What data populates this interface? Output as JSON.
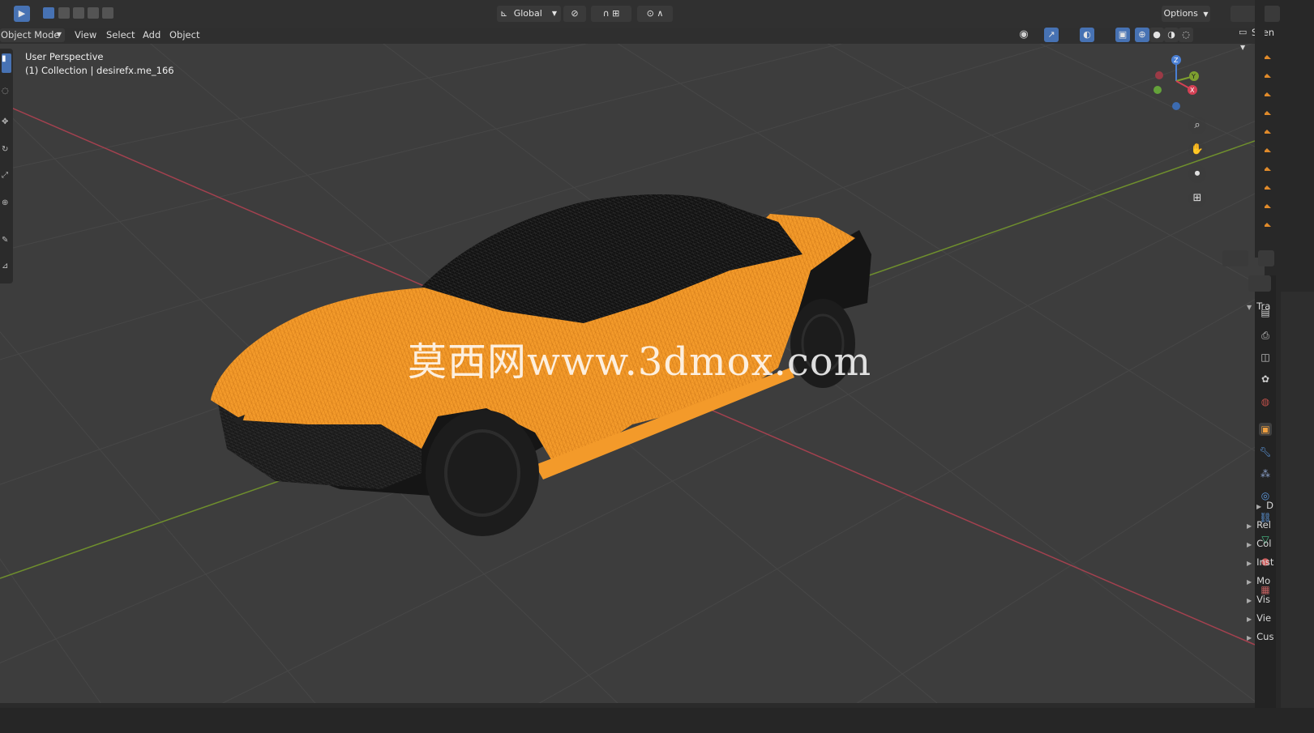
{
  "header": {
    "transform_orientation": "Global",
    "options_label": "Options"
  },
  "menubar": {
    "mode": "Object Mode",
    "items": [
      "View",
      "Select",
      "Add",
      "Object"
    ]
  },
  "viewport": {
    "perspective_label": "User Perspective",
    "collection_label": "(1) Collection | desirefx.me_166",
    "watermark": "莫西网www.3dmox.com",
    "axis_labels": {
      "z": "Z",
      "y": "Y",
      "x": "X"
    }
  },
  "outliner": {
    "title": "Scen"
  },
  "properties": {
    "section_transform": "Tra",
    "collapsed_sections": [
      "Rel",
      "Col",
      "Inst",
      "Mo",
      "Vis",
      "Vie",
      "Cus"
    ],
    "delta_label": "D"
  },
  "colors": {
    "accent_blue": "#4772b3",
    "wireframe_orange": "#f39a2a",
    "x_axis": "#a3414f",
    "y_axis": "#6f8f2d",
    "background": "#3d3d3d"
  },
  "icons": [
    "select-box-icon",
    "cursor-icon",
    "move-icon",
    "rotate-icon",
    "scale-icon",
    "zoom-icon",
    "hand-pan-icon",
    "camera-icon",
    "grid-icon",
    "overlay-icon",
    "xray-icon",
    "wireframe-icon",
    "solid-icon",
    "material-icon",
    "rendered-icon"
  ]
}
